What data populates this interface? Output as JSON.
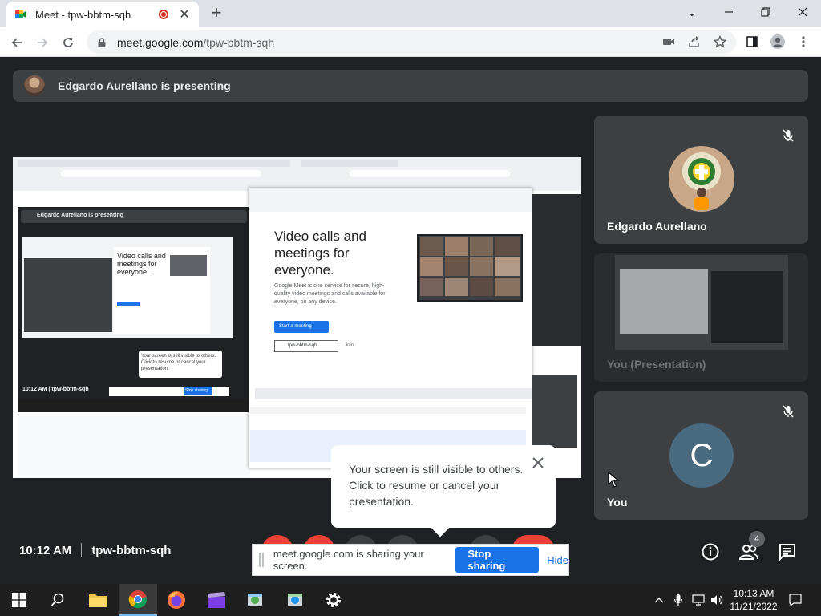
{
  "browser": {
    "tab_title": "Meet - tpw-bbtm-sqh",
    "url_host": "meet.google.com",
    "url_path": "/tpw-bbtm-sqh"
  },
  "meet": {
    "presenting_text": "Edgardo Aurellano is presenting",
    "time": "10:12 AM",
    "meeting_code": "tpw-bbtm-sqh",
    "participants_count": "4",
    "popup_text": "Your screen is still visible to others. Click to resume or cancel your presentation.",
    "share_text": "meet.google.com is sharing your screen.",
    "stop_sharing": "Stop sharing",
    "hide": "Hide",
    "tiles": [
      {
        "name": "Edgardo Aurellano"
      },
      {
        "name": "You (Presentation)"
      },
      {
        "name": "You",
        "initial": "C"
      }
    ],
    "shared_screen": {
      "hero": "Video calls and meetings for everyone.",
      "body": "Google Meet is one service for secure, high-quality video meetings and calls available for everyone, on any device.",
      "start_meeting": "Start a meeting",
      "code": "tpw-bbtm-sqh",
      "join": "Join",
      "inner_presenting": "Edgardo Aurellano is presenting",
      "inner_time": "10:12 AM",
      "inner_code": "tpw-bbtm-sqh",
      "inner_popup": "Your screen is still visible to others. Click to resume or cancel your presentation.",
      "inner_stop": "Stop sharing"
    }
  },
  "taskbar": {
    "time": "10:13 AM",
    "date": "11/21/2022"
  },
  "colors": {
    "meet_bg": "#202124",
    "tile_bg": "#3c4043",
    "accent": "#1a73e8"
  }
}
